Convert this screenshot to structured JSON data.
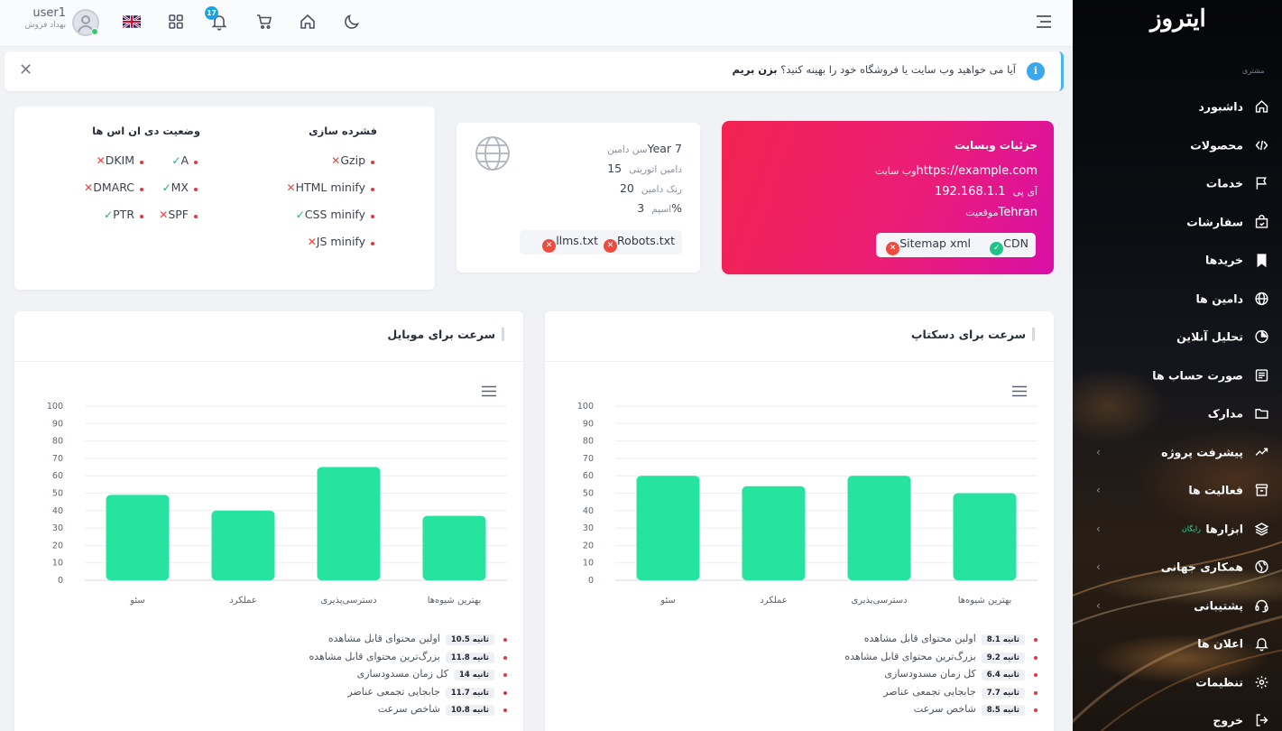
{
  "brand": {
    "logo_text": "ایتروز",
    "section_label": "مشتری"
  },
  "sidebar": {
    "items": [
      {
        "label": "داشبورد",
        "icon": "home-icon",
        "chevron": false
      },
      {
        "label": "محصولات",
        "icon": "code-icon",
        "chevron": false
      },
      {
        "label": "خدمات",
        "icon": "flag-icon",
        "chevron": false
      },
      {
        "label": "سفارشات",
        "icon": "shopping-bag-icon",
        "chevron": false
      },
      {
        "label": "خریدها",
        "icon": "bookmark-icon",
        "chevron": false
      },
      {
        "label": "دامین ها",
        "icon": "globe-icon",
        "chevron": false
      },
      {
        "label": "تحلیل آنلاین",
        "icon": "pie-chart-icon",
        "chevron": false
      },
      {
        "label": "صورت حساب ها",
        "icon": "invoice-icon",
        "chevron": false
      },
      {
        "label": "مدارک",
        "icon": "folder-icon",
        "chevron": false
      },
      {
        "label": "پیشرفت پروژه",
        "icon": "trending-up-icon",
        "chevron": true
      },
      {
        "label": "فعالیت ها",
        "icon": "archive-icon",
        "chevron": true
      },
      {
        "label": "ابزارها",
        "icon": "layers-icon",
        "chevron": true,
        "badge": "رایگان"
      },
      {
        "label": "همکاری جهانی",
        "icon": "world-icon",
        "chevron": true
      },
      {
        "label": "پشتیبانی",
        "icon": "headset-icon",
        "chevron": true
      },
      {
        "label": "اعلان ها",
        "icon": "bell-icon",
        "chevron": false
      },
      {
        "label": "تنظیمات",
        "icon": "settings-icon",
        "chevron": false
      },
      {
        "label": "خروج",
        "icon": "logout-icon",
        "chevron": false
      }
    ]
  },
  "header": {
    "username": "user1",
    "role": "بهداد فروش",
    "notification_count": "17"
  },
  "alert": {
    "text": "آیا می خواهید وب سایت یا فروشگاه خود را بهینه کنید؟",
    "action": "بزن بریم",
    "close": "✕"
  },
  "website_card": {
    "title": "جزئیات وبسایت",
    "rows": [
      {
        "key": "وب سایت",
        "value": "https://example.com"
      },
      {
        "key": "آی پی",
        "value": "192.168.1.1"
      },
      {
        "key": "موقعیت",
        "value": "Tehran"
      }
    ],
    "pills": [
      {
        "label": "CDN",
        "status": "ok"
      },
      {
        "label": "Sitemap xml",
        "status": "no"
      }
    ],
    "colors": {
      "from": "#f2234f",
      "to": "#d80fa6"
    }
  },
  "domain_card": {
    "rows": [
      {
        "key": "سن دامین",
        "value": "Year 7"
      },
      {
        "key": "دامین اتوریتی",
        "value": "15"
      },
      {
        "key": "رنک دامین",
        "value": "20"
      },
      {
        "key": "اسپم",
        "value": "3%"
      }
    ],
    "pills": [
      {
        "label": "Robots.txt",
        "status": "no"
      },
      {
        "label": "llms.txt",
        "status": "no"
      }
    ]
  },
  "compression": {
    "title": "فشرده سازی",
    "items": [
      {
        "label": "Gzip",
        "status": "no"
      },
      {
        "label": "HTML minify",
        "status": "no"
      },
      {
        "label": "CSS minify",
        "status": "ok"
      },
      {
        "label": "JS minify",
        "status": "no"
      }
    ]
  },
  "dns": {
    "title": "وضعیت دی ان اس ها",
    "items": [
      {
        "label": "A",
        "status": "ok"
      },
      {
        "label": "DKIM",
        "status": "no"
      },
      {
        "label": "MX",
        "status": "ok"
      },
      {
        "label": "DMARC",
        "status": "no"
      },
      {
        "label": "SPF",
        "status": "no"
      },
      {
        "label": "PTR",
        "status": "ok"
      }
    ]
  },
  "chart_data": [
    {
      "type": "bar",
      "title": "سرعت برای دسکتاپ",
      "categories": [
        "بهترین شیوه‌ها",
        "دسترسی‌پذیری",
        "عملکرد",
        "سئو"
      ],
      "values": [
        50,
        60,
        54,
        60
      ],
      "ylim": [
        0,
        100
      ],
      "yticks": [
        0,
        10,
        20,
        30,
        40,
        50,
        60,
        70,
        80,
        90,
        100
      ],
      "grid": true,
      "bar_color": "#27e3a0",
      "metrics": [
        {
          "label": "اولین محتوای قابل مشاهده",
          "value": "8.1 ثانیه"
        },
        {
          "label": "بزرگ‌ترین محتوای قابل مشاهده",
          "value": "9.2 ثانیه"
        },
        {
          "label": "کل زمان مسدودسازی",
          "value": "6.4 ثانیه"
        },
        {
          "label": "جابجایی تجمعی عناصر",
          "value": "7.7 ثانیه"
        },
        {
          "label": "شاخص سرعت",
          "value": "8.5 ثانیه"
        }
      ]
    },
    {
      "type": "bar",
      "title": "سرعت برای موبایل",
      "categories": [
        "بهترین شیوه‌ها",
        "دسترسی‌پذیری",
        "عملکرد",
        "سئو"
      ],
      "values": [
        37,
        65,
        40,
        49
      ],
      "ylim": [
        0,
        100
      ],
      "yticks": [
        0,
        10,
        20,
        30,
        40,
        50,
        60,
        70,
        80,
        90,
        100
      ],
      "grid": true,
      "bar_color": "#27e3a0",
      "metrics": [
        {
          "label": "اولین محتوای قابل مشاهده",
          "value": "10.5 ثانیه"
        },
        {
          "label": "بزرگ‌ترین محتوای قابل مشاهده",
          "value": "11.8 ثانیه"
        },
        {
          "label": "کل زمان مسدودسازی",
          "value": "14 ثانیه"
        },
        {
          "label": "جابجایی تجمعی عناصر",
          "value": "11.7 ثانیه"
        },
        {
          "label": "شاخص سرعت",
          "value": "10.8 ثانیه"
        }
      ]
    }
  ]
}
